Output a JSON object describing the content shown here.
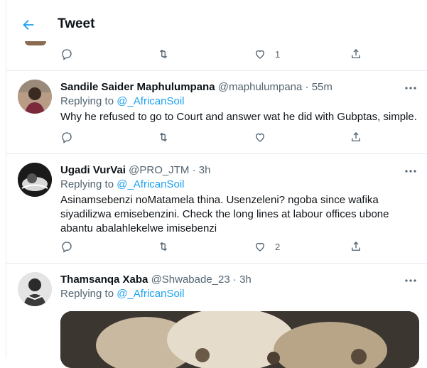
{
  "header": {
    "title": "Tweet"
  },
  "tweets": [
    {
      "name": "",
      "handle": "",
      "time": "",
      "replying_label": "",
      "replying_to": "",
      "text": "",
      "likes": "1"
    },
    {
      "name": "Sandile Saider Maphulumpana",
      "handle": "@maphulumpana",
      "time": "55m",
      "replying_label": "Replying to",
      "replying_to": "@_AfricanSoil",
      "text": "Why he refused to go to Court and answer wat he did with Gubptas, simple.",
      "likes": ""
    },
    {
      "name": "Ugadi VurVai",
      "handle": "@PRO_JTM",
      "time": "3h",
      "replying_label": "Replying to",
      "replying_to": "@_AfricanSoil",
      "text": "Asinamsebenzi noMatamela thina. Usenzeleni? ngoba since wafika siyadilizwa emisebenzini. Check the long lines at labour offices ubone abantu abalahlekelwe imisebenzi",
      "likes": "2"
    },
    {
      "name": "Thamsanqa Xaba",
      "handle": "@Shwabade_23",
      "time": "3h",
      "replying_label": "Replying to",
      "replying_to": "@_AfricanSoil",
      "text": "",
      "likes": ""
    }
  ],
  "colors": {
    "accent": "#1da1f2",
    "muted": "#536471",
    "border": "#e6ecf0"
  }
}
